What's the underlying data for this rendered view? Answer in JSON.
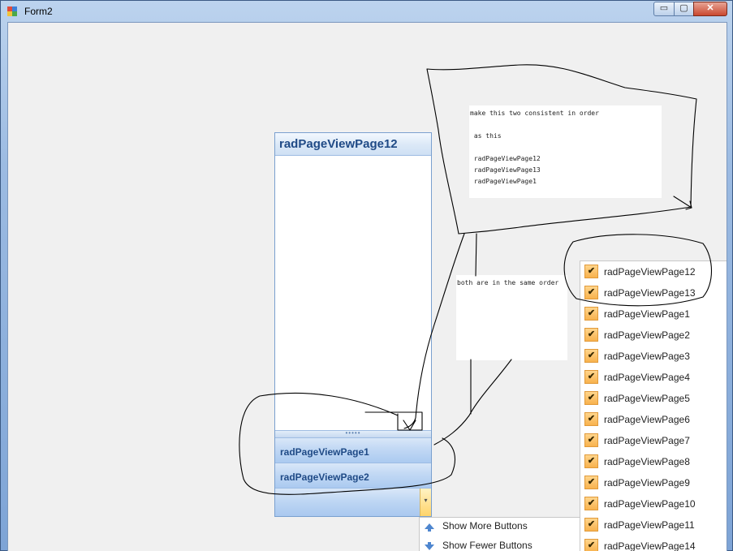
{
  "window": {
    "title": "Form2",
    "min_label": "▭",
    "max_label": "▢",
    "close_label": "✕"
  },
  "page_view": {
    "selected_title": "radPageViewPage12",
    "splitter_grip": "•••••",
    "items": [
      {
        "label": "radPageViewPage1"
      },
      {
        "label": "radPageViewPage2"
      }
    ],
    "overflow_arrow": "▾"
  },
  "notes": {
    "note1": {
      "lines": [
        "make this two consistent in order",
        "",
        " as this",
        "",
        " radPageViewPage12",
        " radPageViewPage13",
        " radPageViewPage1"
      ]
    },
    "note2": {
      "lines": [
        "both are in the same order"
      ]
    }
  },
  "overflow_menu": {
    "items": [
      {
        "label": "Show More Buttons",
        "icon": "arrow-up-icon"
      },
      {
        "label": "Show Fewer Buttons",
        "icon": "arrow-down-icon"
      }
    ]
  },
  "check_menu": {
    "check_glyph": "✔",
    "items": [
      {
        "label": "radPageViewPage12",
        "checked": true
      },
      {
        "label": "radPageViewPage13",
        "checked": true
      },
      {
        "label": "radPageViewPage1",
        "checked": true
      },
      {
        "label": "radPageViewPage2",
        "checked": true
      },
      {
        "label": "radPageViewPage3",
        "checked": true
      },
      {
        "label": "radPageViewPage4",
        "checked": true
      },
      {
        "label": "radPageViewPage5",
        "checked": true
      },
      {
        "label": "radPageViewPage6",
        "checked": true
      },
      {
        "label": "radPageViewPage7",
        "checked": true
      },
      {
        "label": "radPageViewPage8",
        "checked": true
      },
      {
        "label": "radPageViewPage9",
        "checked": true
      },
      {
        "label": "radPageViewPage10",
        "checked": true
      },
      {
        "label": "radPageViewPage11",
        "checked": true
      },
      {
        "label": "radPageViewPage14",
        "checked": true
      }
    ]
  },
  "colors": {
    "accent": "#1f4a86",
    "check_fill": "#f8b24e",
    "annotation_ink": "#000000"
  }
}
